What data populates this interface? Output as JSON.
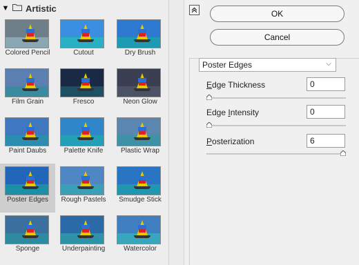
{
  "gallery": {
    "category": "Artistic",
    "filters": [
      {
        "label": "Colored Pencil",
        "sky": "#6f7f8a",
        "sea": "#8aa6b2"
      },
      {
        "label": "Cutout",
        "sky": "#3a8fe0",
        "sea": "#2ab0c4"
      },
      {
        "label": "Dry Brush",
        "sky": "#2d7ad0",
        "sea": "#1d9bb3"
      },
      {
        "label": "Film Grain",
        "sky": "#5a7fb0",
        "sea": "#3a8aa0"
      },
      {
        "label": "Fresco",
        "sky": "#1a2a44",
        "sea": "#1f4f63"
      },
      {
        "label": "Neon Glow",
        "sky": "#3c3f52",
        "sea": "#4c5266"
      },
      {
        "label": "Paint Daubs",
        "sky": "#3f78c0",
        "sea": "#2b8db0"
      },
      {
        "label": "Palette Knife",
        "sky": "#2f86c8",
        "sea": "#23a0b8"
      },
      {
        "label": "Plastic Wrap",
        "sky": "#5a86b0",
        "sea": "#3f92a6"
      },
      {
        "label": "Poster Edges",
        "sky": "#2166b8",
        "sea": "#1a8fa6"
      },
      {
        "label": "Rough Pastels",
        "sky": "#4f86c4",
        "sea": "#3b9fb8"
      },
      {
        "label": "Smudge Stick",
        "sky": "#2a74c4",
        "sea": "#2196b0"
      },
      {
        "label": "Sponge",
        "sky": "#3a6f9e",
        "sea": "#2e8aa0"
      },
      {
        "label": "Underpainting",
        "sky": "#2b6aa8",
        "sea": "#2d92aa"
      },
      {
        "label": "Watercolor",
        "sky": "#3f7fc0",
        "sea": "#3aa6bd"
      }
    ],
    "selected": "Poster Edges"
  },
  "buttons": {
    "ok": "OK",
    "cancel": "Cancel"
  },
  "filter_select": {
    "value": "Poster Edges"
  },
  "params": [
    {
      "label_u": "E",
      "label_rest": "dge Thickness",
      "value": "0",
      "level_percent": 0
    },
    {
      "label_pre": "Edge ",
      "label_u": "I",
      "label_rest": "ntensity",
      "value": "0",
      "level_percent": 0
    },
    {
      "label_u": "P",
      "label_rest": "osterization",
      "value": "6",
      "level_percent": 100
    }
  ],
  "colors": {
    "accent_border": "#7a7a7a",
    "selected_bg": "#cfcfcf"
  }
}
